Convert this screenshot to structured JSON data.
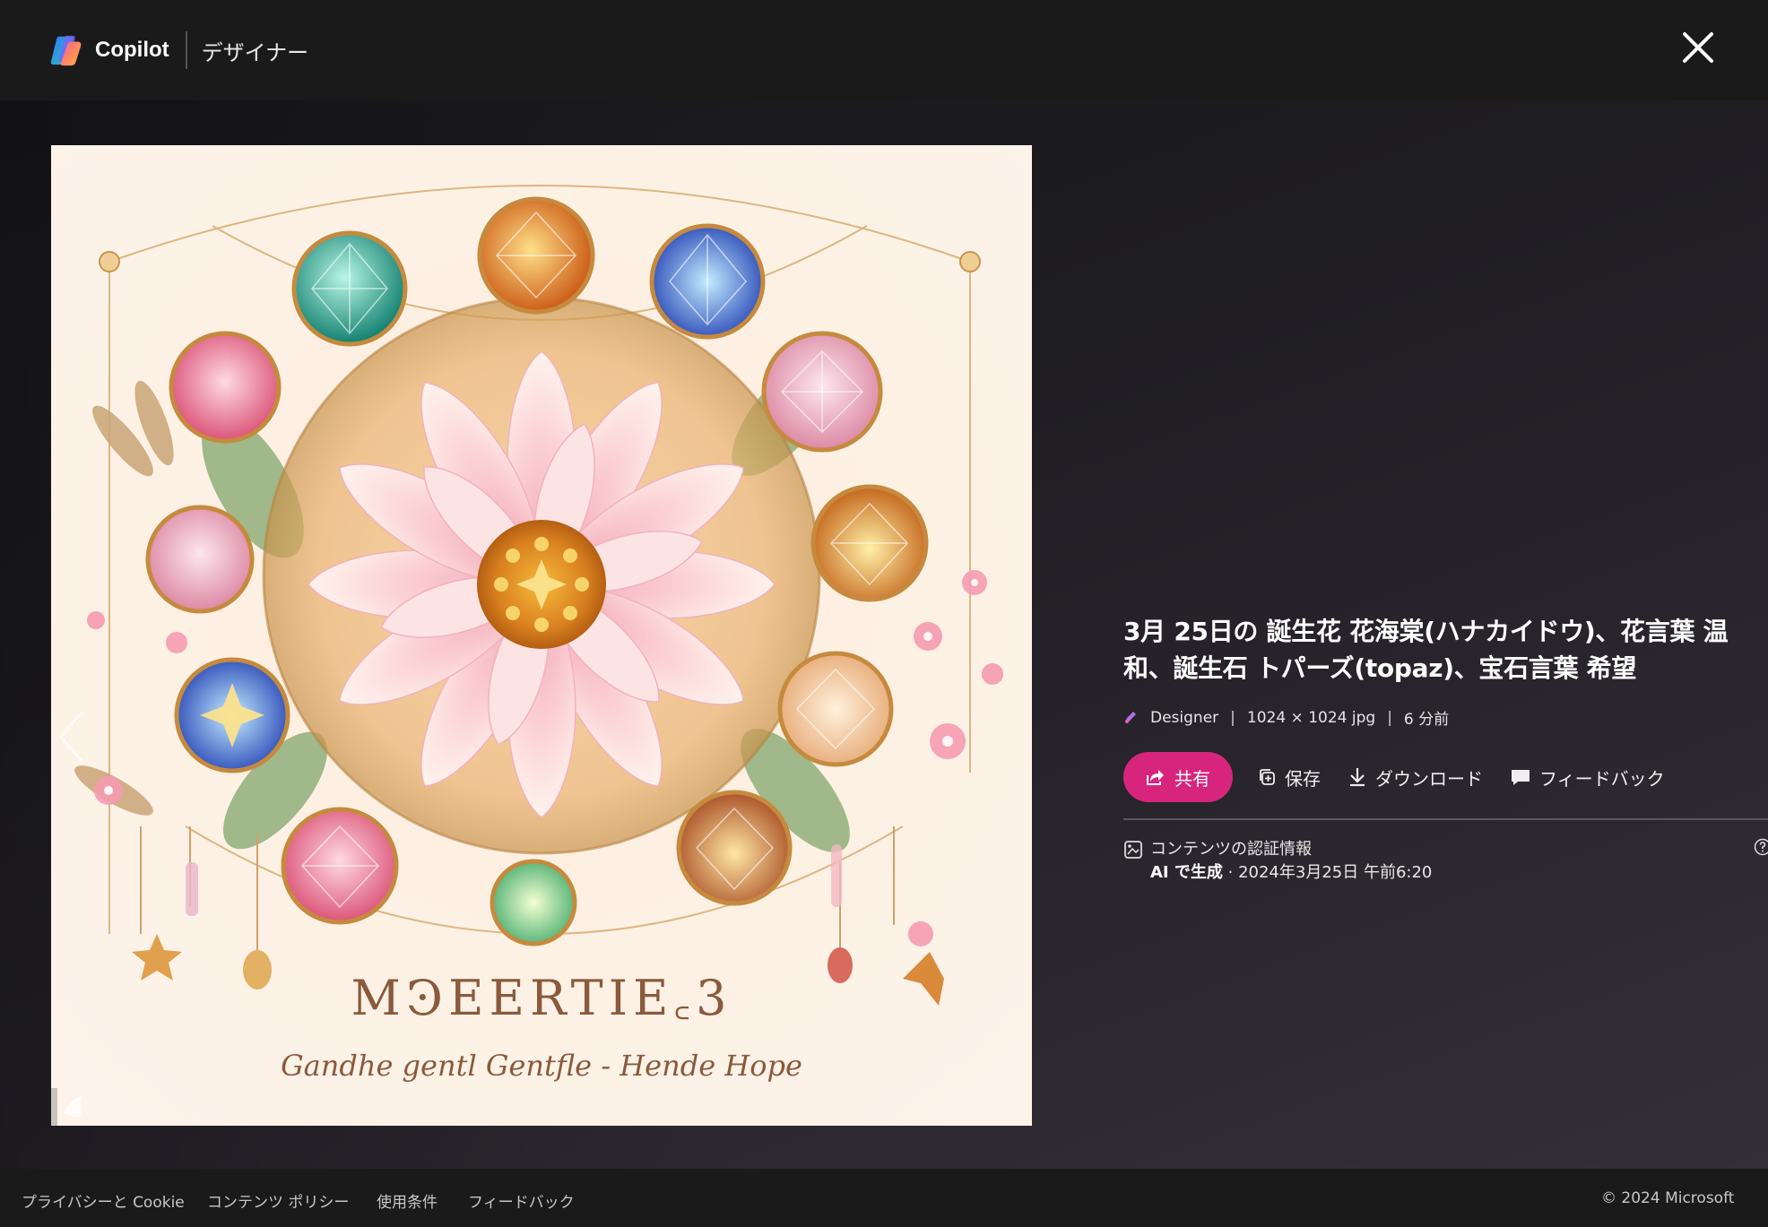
{
  "header": {
    "brand_name": "Copilot",
    "product_name": "デザイナー"
  },
  "image": {
    "headline": "MꜾEERTIE꜀3",
    "subline": "Gandhe gentl  Gentfle - Hende Hope"
  },
  "details": {
    "title": "3月 25日の 誕生花 花海棠(ハナカイドウ)、花言葉 温和、誕生石 トパーズ(topaz)、宝石言葉 希望",
    "source": "Designer",
    "dimensions": "1024 × 1024 jpg",
    "age": "6 分前",
    "separator": "|"
  },
  "actions": {
    "share": "共有",
    "save": "保存",
    "download": "ダウンロード",
    "feedback": "フィードバック"
  },
  "credentials": {
    "title": "コンテンツの認証情報",
    "generated_label": "AI で生成",
    "date": " · 2024年3月25日 午前6:20"
  },
  "footer": {
    "privacy": "プライバシーと Cookie",
    "content_policy": "コンテンツ ポリシー",
    "terms": "使用条件",
    "feedback": "フィードバック",
    "copyright": "© 2024 Microsoft"
  },
  "colors": {
    "share_button": "#d7257d",
    "page_background": "#1d1c1e"
  }
}
